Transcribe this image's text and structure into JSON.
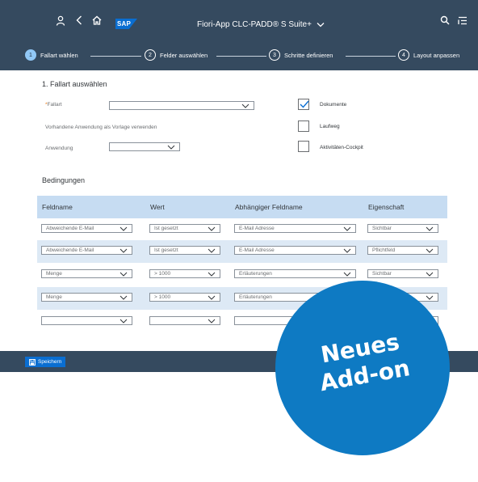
{
  "shell": {
    "logo": "SAP",
    "title": "Fiori-App  CLC-PADD® S Suite+"
  },
  "wizard": {
    "steps": [
      {
        "num": "1",
        "label": "Fallart wählen"
      },
      {
        "num": "2",
        "label": "Felder auswählen"
      },
      {
        "num": "3",
        "label": "Schritte definieren"
      },
      {
        "num": "4",
        "label": "Layout anpassen"
      }
    ]
  },
  "section1": {
    "title": "1. Fallart auswählen",
    "fallart_required": "*",
    "fallart_label": "Fallart",
    "fallart_value": "",
    "template_hint": "Vorhandene Anwendung als Vorlage verwenden",
    "anwendung_label": "Anwendung",
    "anwendung_value": "",
    "checkboxes": [
      {
        "label": "Dokumente",
        "checked": true
      },
      {
        "label": "Laufweg",
        "checked": false
      },
      {
        "label": "Aktivitäten-Cockpit",
        "checked": false
      }
    ]
  },
  "bedingungen": {
    "title": "Bedingungen",
    "columns": [
      "Feldname",
      "Wert",
      "Abhängiger Feldname",
      "Eigenschaft"
    ],
    "rows": [
      [
        "Abweichende E-Mail",
        "Ist gesetzt",
        "E-Mail Adresse",
        "Sichtbar"
      ],
      [
        "Abweichende E-Mail",
        "Ist gesetzt",
        "E-Mail Adresse",
        "Pflichtfeld"
      ],
      [
        "Menge",
        "> 1000",
        "Erläuterungen",
        "Sichtbar"
      ],
      [
        "Menge",
        "> 1000",
        "Erläuterungen",
        ""
      ],
      [
        "",
        "",
        "",
        ""
      ]
    ]
  },
  "footer": {
    "save_label": "Speichern"
  },
  "badge": {
    "line1": "Neues",
    "line2": "Add-on"
  }
}
